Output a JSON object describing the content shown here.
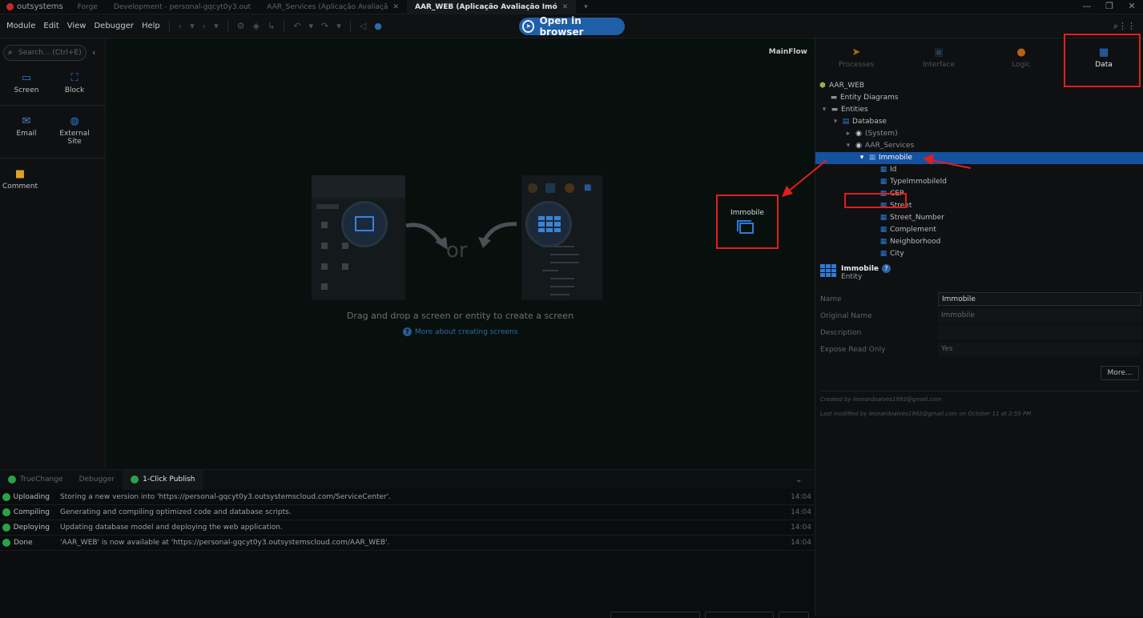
{
  "titlebar": {
    "logo": "outsystems",
    "tabs": [
      {
        "label": "Forge"
      },
      {
        "label": "Development - personal-gqcyt0y3.out"
      },
      {
        "label": "AAR_Services (Aplicação Avaliaçã",
        "close": "✕"
      },
      {
        "label": "AAR_WEB (Aplicação Avaliação Imó",
        "close": "✕"
      }
    ],
    "overflow": "▾",
    "controls": {
      "minimize": "—",
      "restore": "❐",
      "close": "✕"
    }
  },
  "menubar": {
    "items": [
      "Module",
      "Edit",
      "View",
      "Debugger",
      "Help"
    ],
    "open_in_browser": "Open in browser"
  },
  "toolbox": {
    "search_placeholder": "Search... (Ctrl+E)",
    "tools": [
      {
        "label": "Screen",
        "icon": "screen-icon"
      },
      {
        "label": "Block",
        "icon": "block-icon"
      },
      {
        "label": "Email",
        "icon": "email-icon"
      },
      {
        "label": "External Site",
        "icon": "globe-icon"
      },
      {
        "label": "Comment",
        "icon": "comment-icon"
      }
    ]
  },
  "canvas": {
    "flow_name": "MainFlow",
    "or_text": "or",
    "hint": "Drag and drop a screen or entity to create a screen",
    "more_link": "More about creating screens",
    "drop_label": "Immobile"
  },
  "bottom": {
    "tabs": [
      "TrueChange",
      "Debugger",
      "1-Click Publish"
    ],
    "log": [
      {
        "status": "Uploading",
        "message": "Storing a new version into 'https://personal-gqcyt0y3.outsystemscloud.com/ServiceCenter'.",
        "time": "14:04"
      },
      {
        "status": "Compiling",
        "message": "Generating and compiling optimized code and database scripts.",
        "time": "14:04"
      },
      {
        "status": "Deploying",
        "message": "Updating database model and deploying the web application.",
        "time": "14:04"
      },
      {
        "status": "Done",
        "message": "'AAR_WEB' is now available at 'https://personal-gqcyt0y3.outsystemscloud.com/AAR_WEB'.",
        "time": "14:04"
      }
    ]
  },
  "right": {
    "tabs": [
      {
        "label": "Processes",
        "icon": "processes-icon",
        "color": "#b06a14"
      },
      {
        "label": "Interface",
        "icon": "interface-icon",
        "color": "#243b52"
      },
      {
        "label": "Logic",
        "icon": "logic-icon",
        "color": "#b56212"
      },
      {
        "label": "Data",
        "icon": "data-icon",
        "color": "#2f7ad6"
      }
    ],
    "tree": {
      "root": "AAR_WEB",
      "entity_diagrams": "Entity Diagrams",
      "entities": "Entities",
      "database": "Database",
      "system": "(System)",
      "services": "AAR_Services",
      "selected": "Immobile",
      "attributes": [
        "Id",
        "TypeImmobileId",
        "CEP",
        "Street",
        "Street_Number",
        "Complement",
        "Neighborhood",
        "City"
      ]
    },
    "props": {
      "title": "Immobile",
      "type": "Entity",
      "help": "?",
      "rows": [
        {
          "label": "Name",
          "value": "Immobile"
        },
        {
          "label": "Original Name",
          "value": "Immobile"
        },
        {
          "label": "Description",
          "value": ""
        },
        {
          "label": "Expose Read Only",
          "value": "Yes"
        }
      ],
      "more": "More...",
      "created": "Created by leonardoalves1992@gmail.com",
      "modified": "Last modified by leonardoalves1992@gmail.com on October 11 at 2:55 PM"
    }
  }
}
